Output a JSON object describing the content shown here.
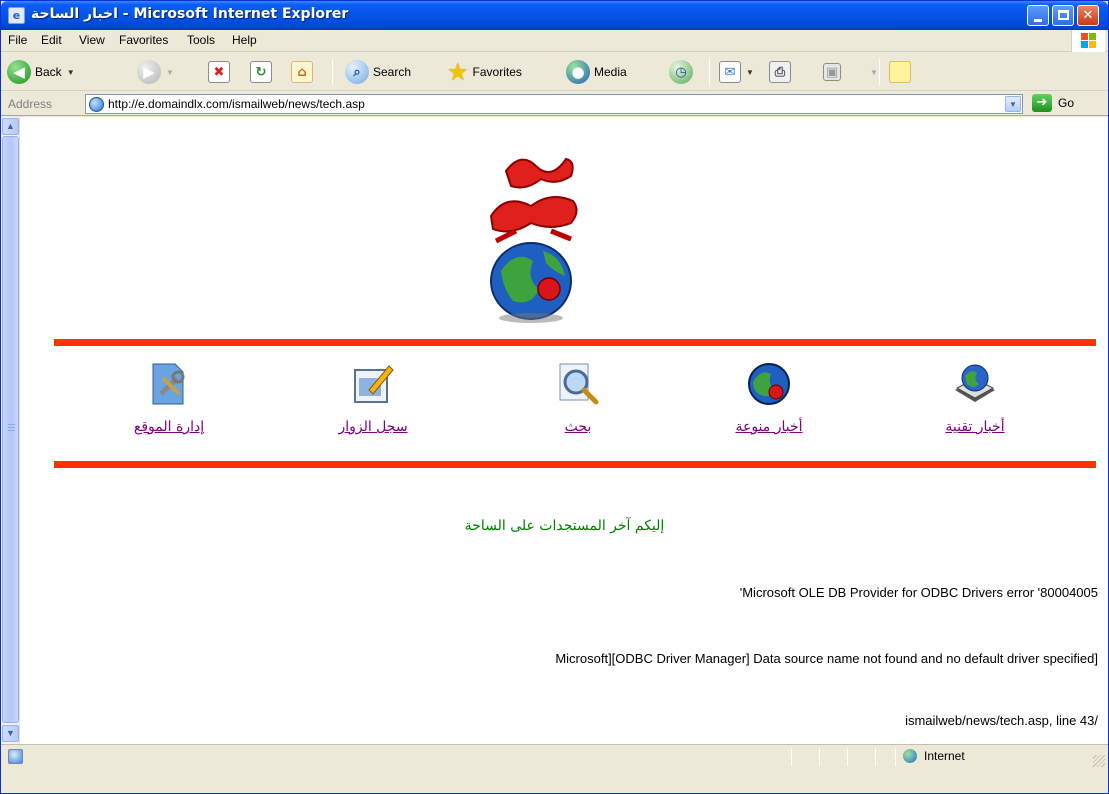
{
  "window": {
    "title": "اخبار الساحة - Microsoft Internet Explorer",
    "controls": {
      "minimize": "minimize",
      "maximize": "maximize",
      "close": "close"
    }
  },
  "menu": [
    "File",
    "Edit",
    "View",
    "Favorites",
    "Tools",
    "Help"
  ],
  "toolbar": {
    "back": "Back",
    "search": "Search",
    "favorites": "Favorites",
    "media": "Media"
  },
  "address": {
    "label": "Address",
    "url": "http://e.domaindlx.com/ismailweb/news/tech.asp",
    "go": "Go"
  },
  "page": {
    "nav": [
      {
        "label": "أخبار تقنية",
        "icon": "globe-book-icon"
      },
      {
        "label": "أخبار منوعة",
        "icon": "globe-icon"
      },
      {
        "label": "بحث",
        "icon": "magnifier-icon"
      },
      {
        "label": "سجل الزوار",
        "icon": "guestbook-icon"
      },
      {
        "label": "إدارة الموقع",
        "icon": "admin-tools-icon"
      }
    ],
    "intro": "إليكم آخر المستجدات على الساحة",
    "errors": [
      "'Microsoft OLE DB Provider for ODBC Drivers error '80004005",
      "Microsoft][ODBC Driver Manager] Data source name not found and no default driver specified]",
      "ismailweb/news/tech.asp, line 43/"
    ]
  },
  "status": {
    "zone": "Internet"
  },
  "colors": {
    "divider": "#ff3300",
    "link": "#800080",
    "intro": "#008000",
    "titlebar": "#0654e6"
  }
}
